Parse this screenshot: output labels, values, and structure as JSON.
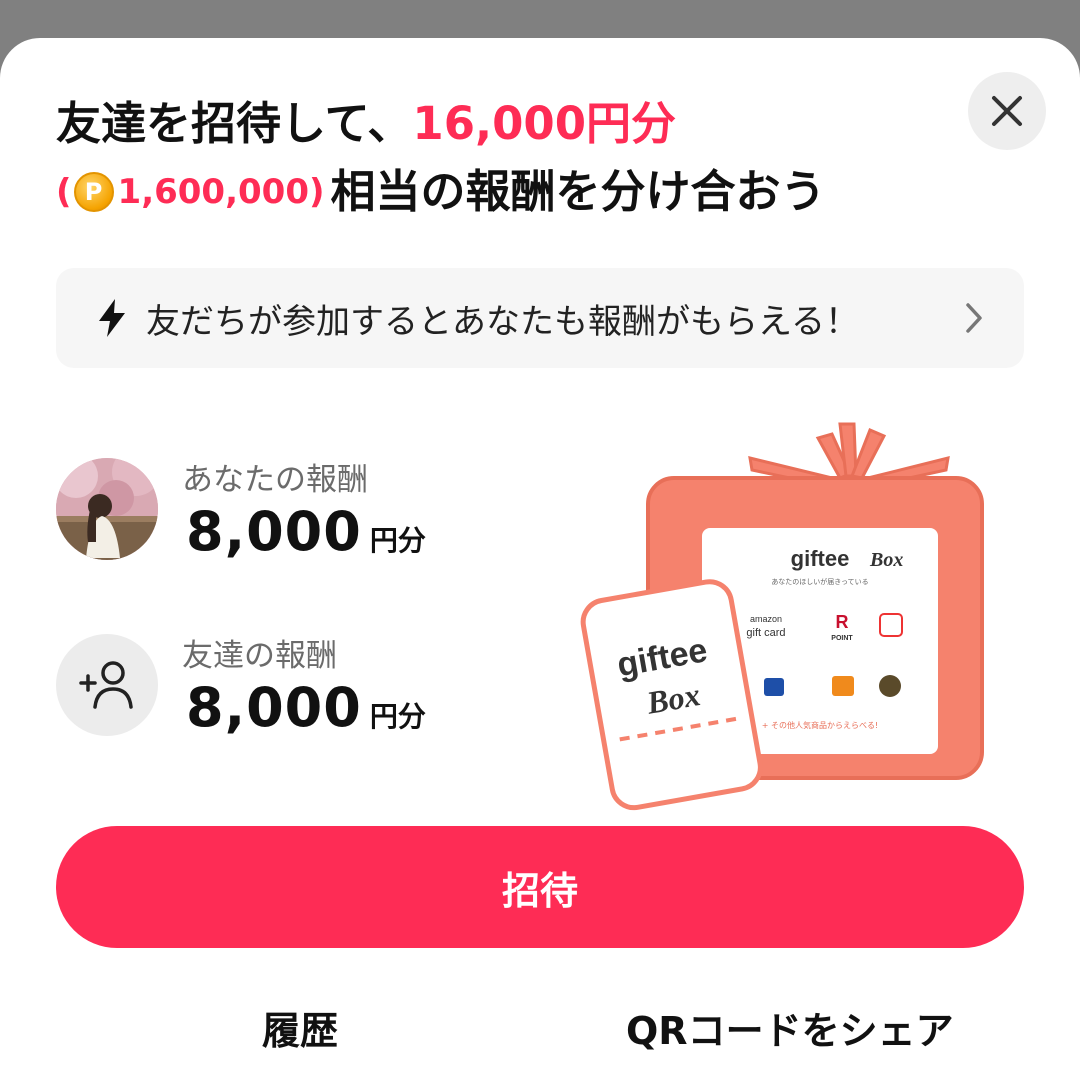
{
  "header": {
    "title_line1_prefix": "友達を招待して、",
    "title_line1_amount": "16,000円分",
    "title_line2_paren_open": "(",
    "coin_symbol": "P",
    "title_line2_points": "1,600,000)",
    "title_line2_suffix": "相当の報酬を分け合おう"
  },
  "banner": {
    "icon": "lightning-icon",
    "text": "友だちが参加するとあなたも報酬がもらえる！"
  },
  "rewards": {
    "you": {
      "label": "あなたの報酬",
      "amount": "8,000",
      "unit": "円分"
    },
    "friend": {
      "label": "友達の報酬",
      "amount": "8,000",
      "unit": "円分"
    }
  },
  "gift_card": {
    "ticket_brand": "giftee",
    "ticket_box": "Box",
    "card_brand": "giftee",
    "card_box": "Box",
    "card_subtitle": "あなたのほしいが届きっている",
    "items": [
      "amazon",
      "gift card",
      "R",
      "POINT"
    ],
    "more_text": "+ その他人気商品からえらべる!"
  },
  "actions": {
    "invite_label": "招待",
    "history_label": "履歴",
    "qr_share_label": "QRコードをシェア"
  },
  "colors": {
    "accent": "#fe2c55",
    "gift_box": "#f5826d",
    "coin": "#f5a300"
  }
}
